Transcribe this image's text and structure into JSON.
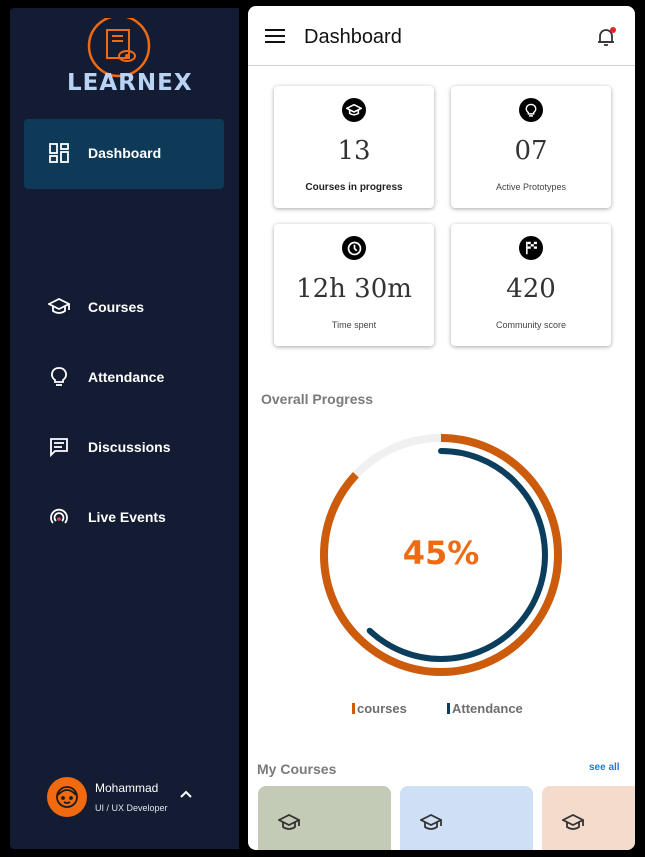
{
  "app": {
    "name": "LEARNEX"
  },
  "colors": {
    "sidebar": "#141c33",
    "active_nav": "#0e3a58",
    "accent": "#ee6a13",
    "navy": "#0b3d5c",
    "link": "#1e7be0"
  },
  "sidebar": {
    "items": [
      {
        "label": "Dashboard",
        "icon": "dashboard-icon",
        "active": true
      },
      {
        "label": "Courses",
        "icon": "graduation-cap-icon"
      },
      {
        "label": "Attendance",
        "icon": "lightbulb-icon"
      },
      {
        "label": "Discussions",
        "icon": "chat-icon"
      },
      {
        "label": "Live Events",
        "icon": "live-broadcast-icon"
      }
    ],
    "profile": {
      "name": "Mohammad",
      "role": "UI / UX Developer"
    }
  },
  "header": {
    "title": "Dashboard"
  },
  "stats": [
    {
      "value": "13",
      "label": "Courses in progress",
      "icon": "graduation-cap-icon"
    },
    {
      "value": "07",
      "label": "Active Prototypes",
      "icon": "lightbulb-icon"
    },
    {
      "value": "12h 30m",
      "label": "Time spent",
      "icon": "clock-icon"
    },
    {
      "value": "420",
      "label": "Community score",
      "icon": "checkered-flag-icon"
    }
  ],
  "progress": {
    "title": "Overall Progress",
    "percent_label": "45%",
    "courses_fraction": 0.87,
    "attendance_fraction": 0.62,
    "legend": [
      {
        "label": "courses",
        "color": "#cc5b0c"
      },
      {
        "label": "Attendance",
        "color": "#0b3d5c"
      }
    ]
  },
  "my_courses": {
    "title": "My Courses",
    "see_all": "see all",
    "cards": [
      {
        "color": "#c3cab6"
      },
      {
        "color": "#cfdff5"
      },
      {
        "color": "#f3dccb"
      }
    ]
  }
}
